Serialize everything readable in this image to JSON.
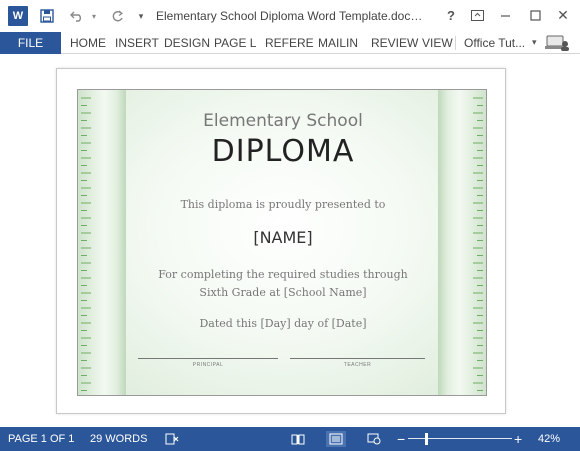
{
  "titlebar": {
    "app_logo": "W",
    "save_icon": "save-icon",
    "undo_icon": "undo-icon",
    "redo_icon": "redo-icon",
    "customize_icon": "customize-icon",
    "title": "Elementary School Diploma Word Template.docx - Word",
    "help_label": "?",
    "ribbon_options_icon": "ribbon-display-options-icon",
    "minimize_icon": "minimize-icon",
    "maximize_icon": "maximize-icon",
    "close_label": "✕"
  },
  "ribbon": {
    "file_label": "FILE",
    "tabs": [
      "HOME",
      "INSERT",
      "DESIGN",
      "PAGE L",
      "REFERE",
      "MAILIN",
      "REVIEW",
      "VIEW"
    ],
    "user_label": "Office Tut..."
  },
  "document": {
    "school": "Elementary School",
    "title": "DIPLOMA",
    "presented": "This diploma is proudly presented to",
    "name": "[NAME]",
    "line1": "For completing the required studies through",
    "line2": "Sixth Grade at [School Name]",
    "dated": "Dated this [Day] day of [Date]",
    "sig_left": "PRINCIPAL",
    "sig_right": "TEACHER"
  },
  "statusbar": {
    "page": "PAGE 1 OF 1",
    "words": "29 WORDS",
    "zoom_out": "−",
    "zoom_in": "+",
    "zoom": "42%",
    "zoom_level": 0.42
  },
  "colors": {
    "accent": "#2b579a",
    "band_green": "#cfe3cc",
    "tick_green": "#6fae62"
  }
}
